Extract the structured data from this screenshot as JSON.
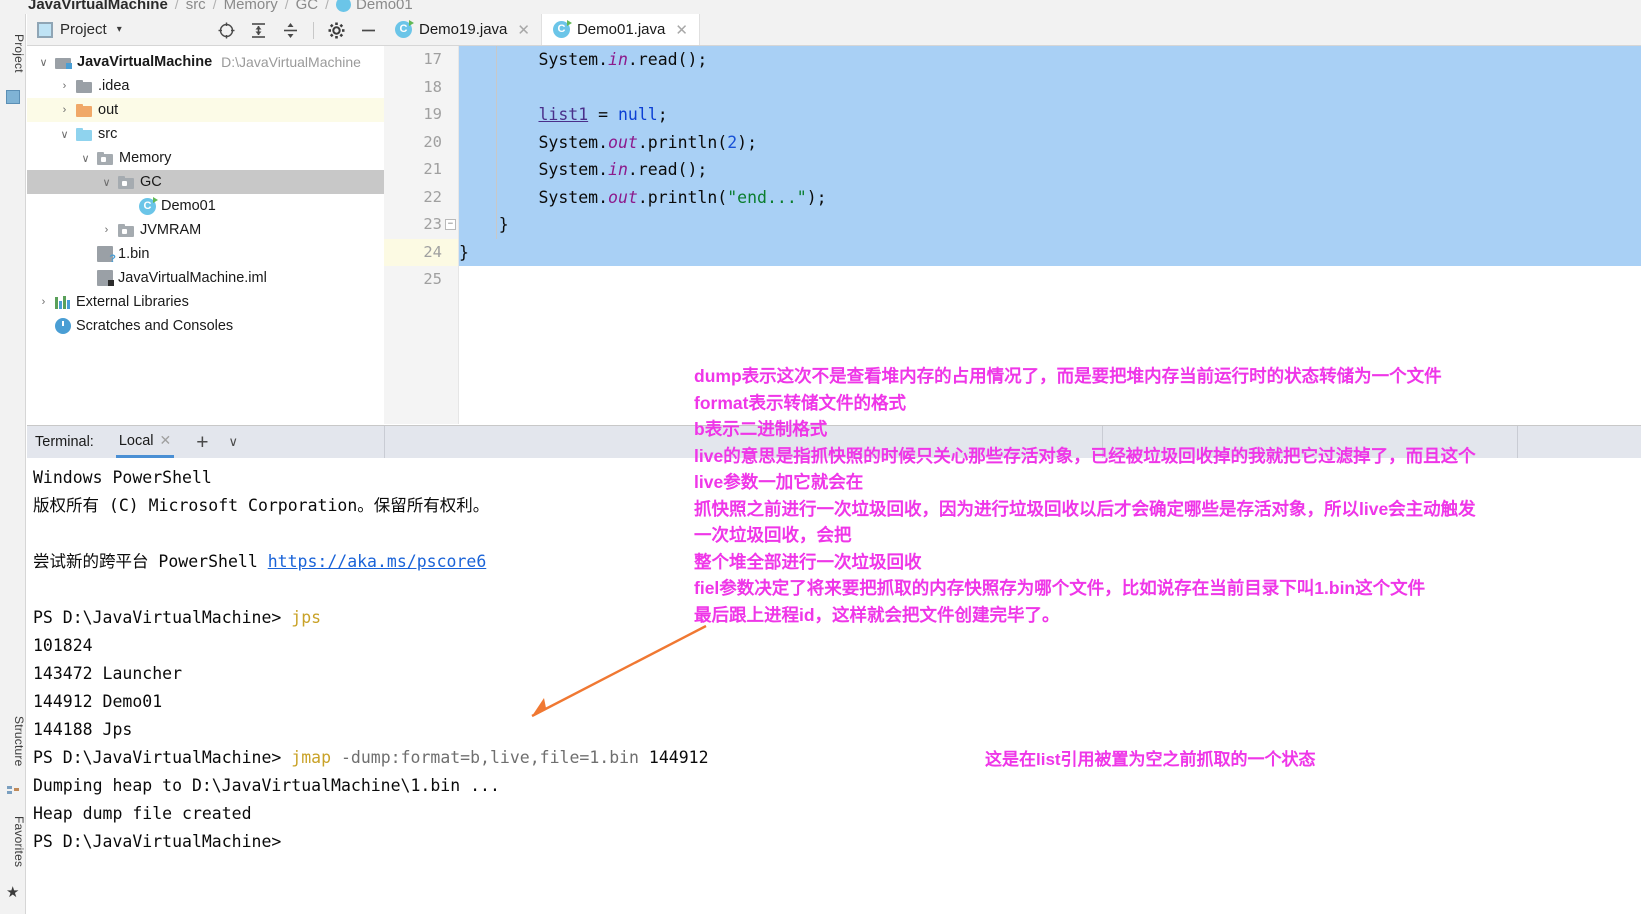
{
  "breadcrumb": {
    "items": [
      "JavaVirtualMachine",
      "src",
      "Memory",
      "GC",
      "Demo01"
    ],
    "separator": "/"
  },
  "left_strip": {
    "tabs": [
      {
        "label": "Project",
        "icon": "project-icon"
      },
      {
        "label": "Structure",
        "icon": "structure-icon"
      },
      {
        "label": "Favorites",
        "icon": "star-icon"
      }
    ]
  },
  "project_panel": {
    "title": "Project",
    "caret": "▾",
    "toolbar_icons": [
      "locate-icon",
      "expand-all-icon",
      "collapse-all-icon",
      "settings-gear-icon",
      "hide-icon"
    ],
    "tree": [
      {
        "indent": 0,
        "arrow": "∨",
        "icon": "module-icon",
        "label": "JavaVirtualMachine",
        "bold": true,
        "path": "D:\\JavaVirtualMachine",
        "highlight": "none"
      },
      {
        "indent": 1,
        "arrow": "›",
        "icon": "folder-gray-icon",
        "label": ".idea",
        "bold": false,
        "path": "",
        "highlight": "none"
      },
      {
        "indent": 1,
        "arrow": "›",
        "icon": "folder-orange-icon",
        "label": "out",
        "bold": false,
        "path": "",
        "highlight": "yellow"
      },
      {
        "indent": 1,
        "arrow": "∨",
        "icon": "folder-blue-icon",
        "label": "src",
        "bold": false,
        "path": "",
        "highlight": "none"
      },
      {
        "indent": 2,
        "arrow": "∨",
        "icon": "package-icon",
        "label": "Memory",
        "bold": false,
        "path": "",
        "highlight": "none"
      },
      {
        "indent": 3,
        "arrow": "∨",
        "icon": "package-icon",
        "label": "GC",
        "bold": false,
        "path": "",
        "highlight": "gray"
      },
      {
        "indent": 4,
        "arrow": "",
        "icon": "java-class-icon",
        "label": "Demo01",
        "bold": false,
        "path": "",
        "highlight": "none"
      },
      {
        "indent": 3,
        "arrow": "›",
        "icon": "package-icon",
        "label": "JVMRAM",
        "bold": false,
        "path": "",
        "highlight": "none"
      },
      {
        "indent": 2,
        "arrow": "",
        "icon": "unknown-file-icon",
        "label": "1.bin",
        "bold": false,
        "path": "",
        "highlight": "none"
      },
      {
        "indent": 2,
        "arrow": "",
        "icon": "iml-file-icon",
        "label": "JavaVirtualMachine.iml",
        "bold": false,
        "path": "",
        "highlight": "none"
      },
      {
        "indent": 0,
        "arrow": "›",
        "icon": "libraries-icon",
        "label": "External Libraries",
        "bold": false,
        "path": "",
        "highlight": "none"
      },
      {
        "indent": 0,
        "arrow": "",
        "icon": "scratches-icon",
        "label": "Scratches and Consoles",
        "bold": false,
        "path": "",
        "highlight": "none"
      }
    ]
  },
  "editor": {
    "tabs": [
      {
        "label": "Demo19.java",
        "active": false,
        "close": "✕"
      },
      {
        "label": "Demo01.java",
        "active": true,
        "close": "✕"
      }
    ],
    "line_numbers": [
      "17",
      "18",
      "19",
      "20",
      "21",
      "22",
      "23",
      "24",
      "25"
    ],
    "current_line": "24",
    "code": [
      {
        "n": "17",
        "text": "        System.in.read();",
        "selected": true
      },
      {
        "n": "18",
        "text": "",
        "selected": true
      },
      {
        "n": "19",
        "text": "        list1 = null;",
        "selected": true
      },
      {
        "n": "20",
        "text": "        System.out.println(2);",
        "selected": true
      },
      {
        "n": "21",
        "text": "        System.in.read();",
        "selected": true
      },
      {
        "n": "22",
        "text": "        System.out.println(\"end...\");",
        "selected": true
      },
      {
        "n": "23",
        "text": "    }",
        "selected": true
      },
      {
        "n": "24",
        "text": "}",
        "selected": true
      },
      {
        "n": "25",
        "text": "",
        "selected": false
      }
    ]
  },
  "terminal": {
    "label": "Terminal:",
    "tab": "Local",
    "tab_close": "✕",
    "add": "+",
    "caret": "∨",
    "lines": [
      "Windows PowerShell",
      "版权所有 (C) Microsoft Corporation。保留所有权利。",
      "",
      "尝试新的跨平台 PowerShell https://aka.ms/pscore6",
      "",
      "PS D:\\JavaVirtualMachine> jps",
      "101824",
      "143472 Launcher",
      "144912 Demo01",
      "144188 Jps",
      "PS D:\\JavaVirtualMachine> jmap -dump:format=b,live,file=1.bin 144912",
      "Dumping heap to D:\\JavaVirtualMachine\\1.bin ...",
      "Heap dump file created",
      "PS D:\\JavaVirtualMachine>"
    ],
    "prompt": "PS D:\\JavaVirtualMachine>",
    "url": "https://aka.ms/pscore6",
    "cmd_jps": "jps",
    "cmd_jmap": "jmap",
    "cmd_jmap_args": " -dump:format=b,live,file=1.bin",
    "cmd_jmap_pid": " 144912"
  },
  "annotations": {
    "color": "#ef36e8",
    "arrow_color": "#f07832",
    "main_lines": [
      "dump表示这次不是查看堆内存的占用情况了，而是要把堆内存当前运行时的状态转储为一个文件",
      "format表示转储文件的格式",
      "b表示二进制格式",
      "live的意思是指抓快照的时候只关心那些存活对象，已经被垃圾回收掉的我就把它过滤掉了，而且这个",
      "live参数一加它就会在",
      "抓快照之前进行一次垃圾回收，因为进行垃圾回收以后才会确定哪些是存活对象，所以live会主动触发",
      "一次垃圾回收，会把",
      "整个堆全部进行一次垃圾回收",
      "fiel参数决定了将来要把抓取的内存快照存为哪个文件，比如说存在当前目录下叫1.bin这个文件",
      "最后跟上进程id，这样就会把文件创建完毕了。"
    ],
    "bottom_note": "这是在list引用被置为空之前抓取的一个状态"
  }
}
